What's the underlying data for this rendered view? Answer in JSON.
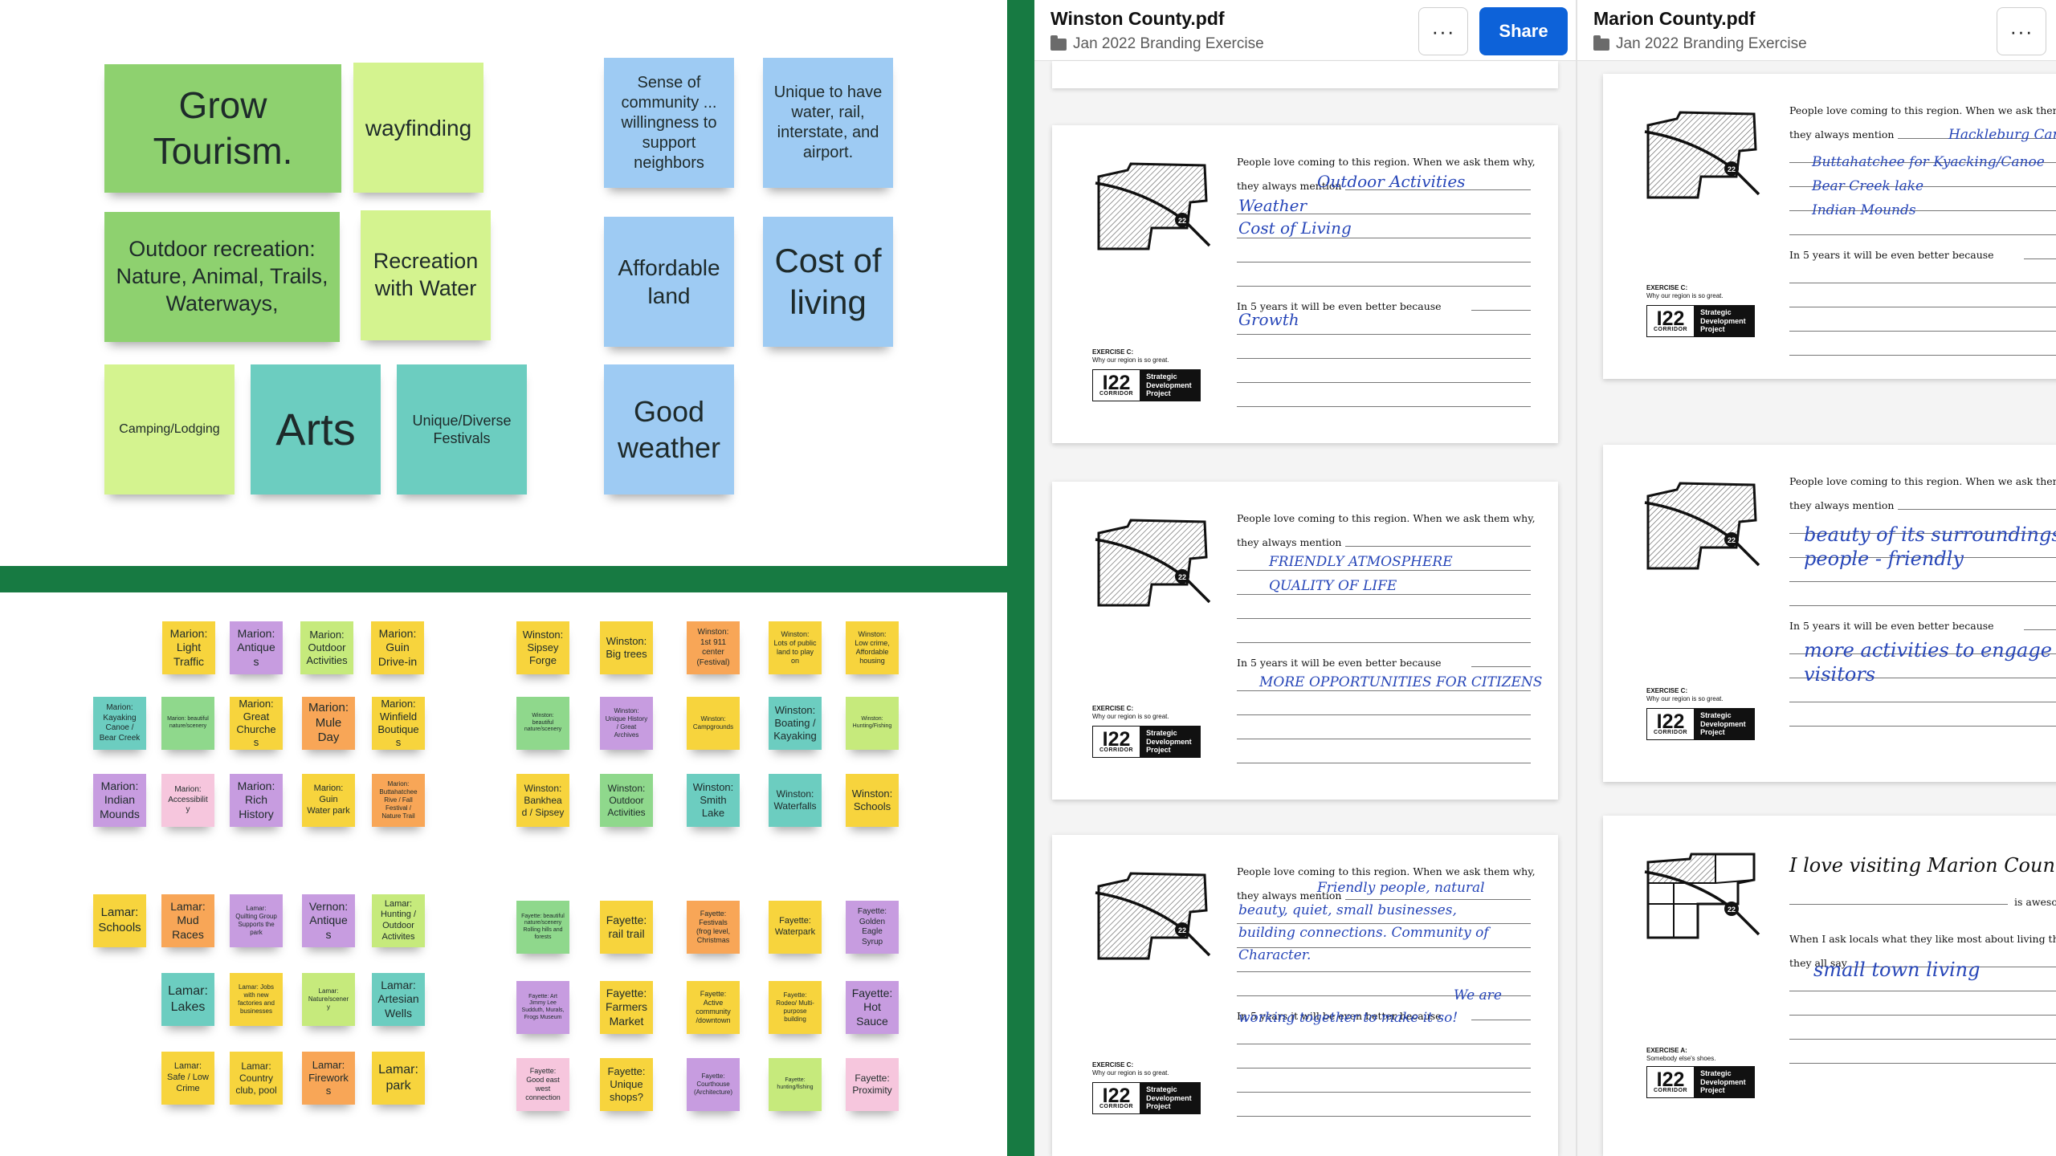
{
  "top_board": {
    "notes": [
      {
        "text": "Grow Tourism.",
        "color": "green",
        "size": 46
      },
      {
        "text": "wayfinding",
        "color": "lime",
        "size": 28
      },
      {
        "text": "Outdoor recreation: Nature, Animal, Trails, Waterways,",
        "color": "green",
        "size": 27
      },
      {
        "text": "Recreation with Water",
        "color": "lime",
        "size": 27
      },
      {
        "text": "Camping/Lodging",
        "color": "lime",
        "size": 16
      },
      {
        "text": "Arts",
        "color": "teal",
        "size": 56
      },
      {
        "text": "Unique/Diverse Festivals",
        "color": "teal",
        "size": 18
      },
      {
        "text": "Sense of community ... willingness to support neighbors",
        "color": "blue",
        "size": 20
      },
      {
        "text": "Unique to have water, rail, interstate, and airport.",
        "color": "blue",
        "size": 20
      },
      {
        "text": "Affordable land",
        "color": "blue",
        "size": 28
      },
      {
        "text": "Cost of living",
        "color": "blue",
        "size": 42
      },
      {
        "text": "Good weather",
        "color": "blue",
        "size": 36
      }
    ]
  },
  "bottom_board": {
    "notes": [
      {
        "text": "Marion: Light Traffic",
        "color": "yellow",
        "size": 14
      },
      {
        "text": "Marion: Antiques",
        "color": "purple",
        "size": 14
      },
      {
        "text": "Marion: Outdoor Activities",
        "color": "lightgreen",
        "size": 13
      },
      {
        "text": "Marion: Guin Drive-in",
        "color": "yellow",
        "size": 14
      },
      {
        "text": "Marion: Kayaking Canoe / Bear Creek",
        "color": "teal",
        "size": 10
      },
      {
        "text": "Marion: beautiful nature/scenery",
        "color": "mint",
        "size": 7
      },
      {
        "text": "Marion: Great Churches",
        "color": "yellow",
        "size": 13
      },
      {
        "text": "Marion: Mule Day",
        "color": "orange",
        "size": 15
      },
      {
        "text": "Marion: Winfield Boutiques",
        "color": "yellow",
        "size": 13
      },
      {
        "text": "Marion: Indian Mounds",
        "color": "purple",
        "size": 14
      },
      {
        "text": "Marion: Accessibility",
        "color": "pink",
        "size": 10
      },
      {
        "text": "Marion: Rich History",
        "color": "purple",
        "size": 14
      },
      {
        "text": "Marion: Guin Water park",
        "color": "yellow",
        "size": 11
      },
      {
        "text": "Marion: Buttahatchee Rive / Fall Festival / Nature Trail",
        "color": "orange",
        "size": 8
      },
      {
        "text": "Winston: Sipsey Forge",
        "color": "yellow",
        "size": 13
      },
      {
        "text": "Winston: Big trees",
        "color": "yellow",
        "size": 13
      },
      {
        "text": "Winston: 1st 911 center (Festival)",
        "color": "orange",
        "size": 10
      },
      {
        "text": "Winston: Lots of public land to play on",
        "color": "yellow",
        "size": 9
      },
      {
        "text": "Winston: Low crime, Affordable housing",
        "color": "yellow",
        "size": 9
      },
      {
        "text": "Winston: beautiful nature/scenery",
        "color": "mint",
        "size": 7
      },
      {
        "text": "Winston: Unique History / Great Archives",
        "color": "purple",
        "size": 8
      },
      {
        "text": "Winston: Campgrounds",
        "color": "yellow",
        "size": 8
      },
      {
        "text": "Winston: Boating / Kayaking",
        "color": "teal",
        "size": 13
      },
      {
        "text": "Winston: Hunting/Fishing",
        "color": "lightgreen",
        "size": 7
      },
      {
        "text": "Winston: Bankhead / Sipsey",
        "color": "yellow",
        "size": 12
      },
      {
        "text": "Winston: Outdoor Activities",
        "color": "mint",
        "size": 12
      },
      {
        "text": "Winston: Smith Lake",
        "color": "teal",
        "size": 13
      },
      {
        "text": "Winston: Waterfalls",
        "color": "teal",
        "size": 12
      },
      {
        "text": "Winston: Schools",
        "color": "yellow",
        "size": 13
      },
      {
        "text": "Lamar: Schools",
        "color": "yellow",
        "size": 15
      },
      {
        "text": "Lamar: Mud Races",
        "color": "orange",
        "size": 14
      },
      {
        "text": "Lamar: Quilting Group Supports the park",
        "color": "purple",
        "size": 8
      },
      {
        "text": "Vernon: Antiques",
        "color": "purple",
        "size": 14
      },
      {
        "text": "Lamar: Hunting / Outdoor Activites",
        "color": "lightgreen",
        "size": 11
      },
      {
        "text": "Lamar: Lakes",
        "color": "teal",
        "size": 16
      },
      {
        "text": "Lamar: Jobs with new factories and businesses",
        "color": "yellow",
        "size": 8
      },
      {
        "text": "Lamar: Nature/scenery",
        "color": "lightgreen",
        "size": 8
      },
      {
        "text": "Lamar: Artesian Wells",
        "color": "teal",
        "size": 14
      },
      {
        "text": "Lamar: Safe / Low Crime",
        "color": "yellow",
        "size": 11
      },
      {
        "text": "Lamar: Country club, pool",
        "color": "yellow",
        "size": 12
      },
      {
        "text": "Lamar: Fireworks",
        "color": "orange",
        "size": 13
      },
      {
        "text": "Lamar: park",
        "color": "yellow",
        "size": 16
      },
      {
        "text": "Fayette: beautiful nature/scenery Rolling hills and forests",
        "color": "mint",
        "size": 7
      },
      {
        "text": "Fayette: rail trail",
        "color": "yellow",
        "size": 14
      },
      {
        "text": "Fayette: Festivals (frog level, Christmas",
        "color": "orange",
        "size": 9
      },
      {
        "text": "Fayette: Waterpark",
        "color": "yellow",
        "size": 11
      },
      {
        "text": "Fayette: Golden Eagle Syrup",
        "color": "purple",
        "size": 10
      },
      {
        "text": "Fayette: Art Jimmy Lee Sudduth, Murals, Frogs Museum",
        "color": "purple",
        "size": 7
      },
      {
        "text": "Fayette: Farmers Market",
        "color": "yellow",
        "size": 14
      },
      {
        "text": "Fayette: Active community /downtown",
        "color": "yellow",
        "size": 9
      },
      {
        "text": "Fayette: Rodeo/ Multi-purpose building",
        "color": "yellow",
        "size": 8
      },
      {
        "text": "Fayette: Hot Sauce",
        "color": "purple",
        "size": 14
      },
      {
        "text": "Fayette: Good east west connection",
        "color": "pink",
        "size": 9
      },
      {
        "text": "Fayette: Unique shops?",
        "color": "yellow",
        "size": 13
      },
      {
        "text": "Fayette: Courthouse (Architecture)",
        "color": "purple",
        "size": 8
      },
      {
        "text": "Fayette: hunting/fishing",
        "color": "lightgreen",
        "size": 7
      },
      {
        "text": "Fayette: Proximity",
        "color": "pink",
        "size": 12
      }
    ]
  },
  "winston": {
    "title": "Winston County.pdf",
    "folder": "Jan 2022 Branding Exercise",
    "more_label": "···",
    "share_label": "Share",
    "pages": [
      {
        "prompt1": "People love coming to this region. When we ask them why,",
        "prompt2": "they always mention",
        "prompt3": "In 5 years it will be even better because",
        "ex1": "EXERCISE C:",
        "ex2": "Why our region is so great.",
        "hw": [
          "Outdoor Activities",
          "Weather",
          "Cost of Living",
          "",
          "Growth"
        ]
      },
      {
        "prompt1": "People love coming to this region. When we ask them why,",
        "prompt2": "they always mention",
        "prompt3": "In 5 years it will be even better because",
        "ex1": "EXERCISE C:",
        "ex2": "Why our region is so great.",
        "hw": [
          "FRIENDLY ATMOSPHERE",
          "QUALITY OF LIFE",
          "",
          "",
          "MORE OPPORTUNITIES FOR CITIZENS"
        ]
      },
      {
        "prompt1": "People love coming to this region. When we ask them why,",
        "prompt2": "they always mention",
        "prompt3": "In 5 years it will be even better because",
        "ex1": "EXERCISE C:",
        "ex2": "Why our region is so great.",
        "hw": [
          "Friendly people, natural",
          "beauty, quiet, small businesses,",
          "building connections. Community of",
          "Character.",
          "We are",
          "working together to make it so!"
        ]
      }
    ]
  },
  "marion": {
    "title": "Marion County.pdf",
    "folder": "Jan 2022 Branding Exercise",
    "more_label": "···",
    "pages": [
      {
        "prompt1": "People love coming to this region. When we ask them why,",
        "prompt2": "they always mention",
        "prompt3": "In 5 years it will be even better because",
        "ex1": "EXERCISE C:",
        "ex2": "Why our region is so great.",
        "hw": [
          "Hackleburg Canoe Launch",
          "Buttahatchee for Kyacking/Canoe",
          "Bear Creek lake",
          "Indian Mounds"
        ]
      },
      {
        "prompt1": "People love coming to this region. When we ask them why,",
        "prompt2": "they always mention",
        "prompt3": "In 5 years it will be even better because",
        "ex1": "EXERCISE C:",
        "ex2": "Why our region is so great.",
        "hw": [
          "beauty of its surroundings",
          "people - friendly",
          "more activities to engage",
          "visitors"
        ]
      },
      {
        "heading": "I love visiting Marion County!",
        "suffix": "is awesome",
        "prompt_a": "When I ask locals what they like most about living there,",
        "prompt_b": "they all say",
        "ex1": "EXERCISE A:",
        "ex2": "Somebody else's shoes.",
        "hw": [
          "small town living"
        ]
      }
    ]
  },
  "logo": {
    "big": "I22",
    "small": "CORRIDOR",
    "line1": "Strategic",
    "line2": "Development",
    "line3": "Project"
  },
  "colors": {
    "green": "#8ed16f",
    "lime": "#d4f38f",
    "teal": "#6ccdc0",
    "blue": "#9ecbf3",
    "yellow": "#f7d43d",
    "purple": "#c79ce0",
    "orange": "#f8a657",
    "pink": "#f6c6dd",
    "mint": "#8fd88c",
    "lightgreen": "#c6ea7c",
    "accent": "#0d62d9",
    "divider": "#177a42"
  }
}
